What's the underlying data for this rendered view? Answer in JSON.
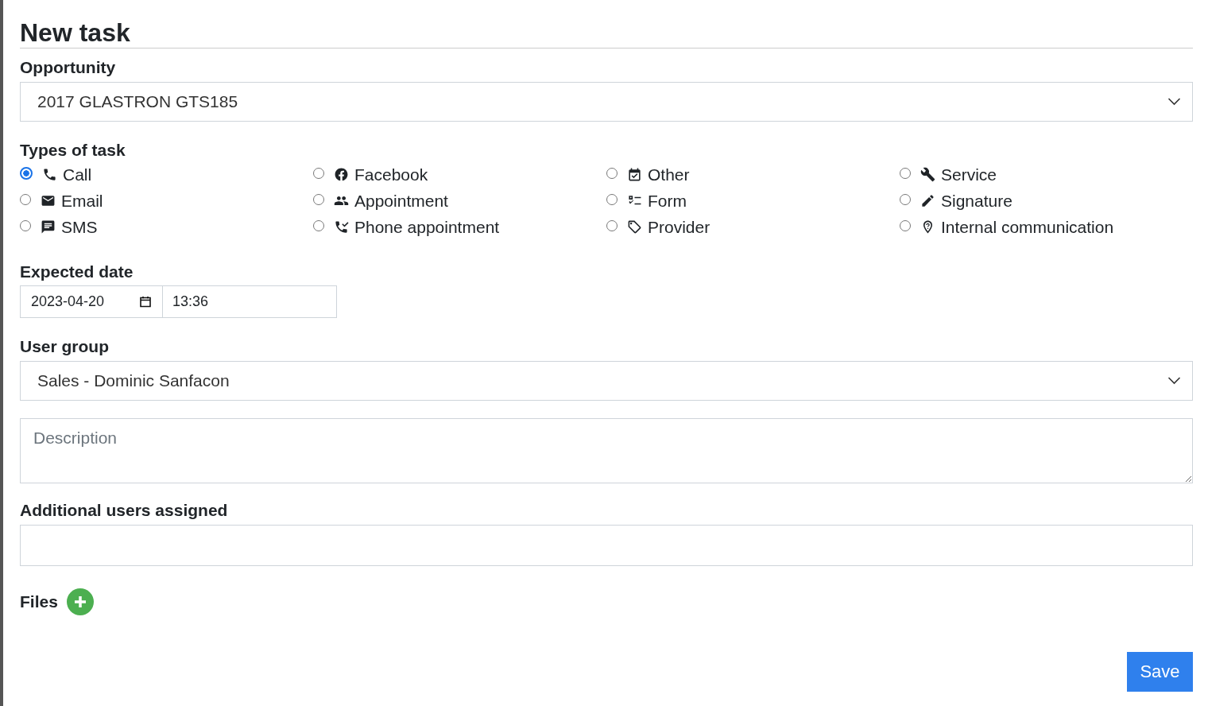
{
  "title": "New task",
  "opportunity": {
    "label": "Opportunity",
    "value": "2017 GLASTRON GTS185"
  },
  "task_types": {
    "label": "Types of task",
    "options": [
      {
        "label": "Call",
        "selected": true
      },
      {
        "label": "Email",
        "selected": false
      },
      {
        "label": "SMS",
        "selected": false
      },
      {
        "label": "Facebook",
        "selected": false
      },
      {
        "label": "Appointment",
        "selected": false
      },
      {
        "label": "Phone appointment",
        "selected": false
      },
      {
        "label": "Other",
        "selected": false
      },
      {
        "label": "Form",
        "selected": false
      },
      {
        "label": "Provider",
        "selected": false
      },
      {
        "label": "Service",
        "selected": false
      },
      {
        "label": "Signature",
        "selected": false
      },
      {
        "label": "Internal communication",
        "selected": false
      }
    ]
  },
  "expected_date": {
    "label": "Expected date",
    "date": "2023-04-20",
    "time": "13:36"
  },
  "user_group": {
    "label": "User group",
    "value": "Sales - Dominic Sanfacon"
  },
  "description": {
    "placeholder": "Description"
  },
  "additional_users": {
    "label": "Additional users assigned"
  },
  "files": {
    "label": "Files"
  },
  "save_button": "Save"
}
